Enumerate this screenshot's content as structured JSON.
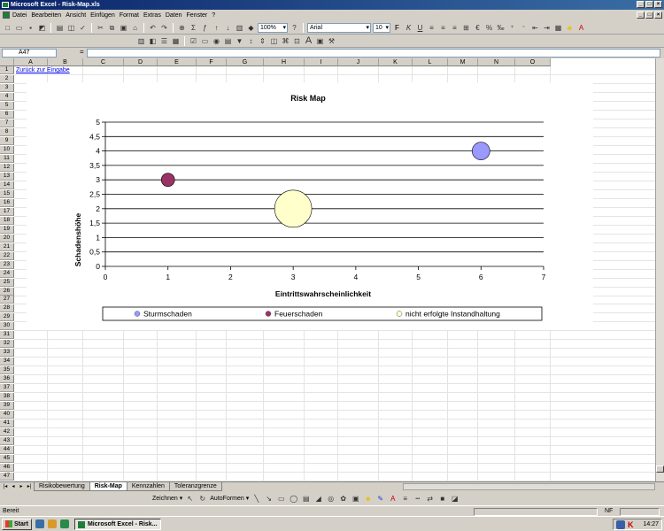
{
  "window": {
    "title": "Microsoft Excel - Risk-Map.xls",
    "controls": [
      "_",
      "□",
      "×"
    ]
  },
  "menu": {
    "items": [
      "Datei",
      "Bearbeiten",
      "Ansicht",
      "Einfügen",
      "Format",
      "Extras",
      "Daten",
      "Fenster",
      "?"
    ]
  },
  "toolbar": {
    "zoom": "100%",
    "font": "Arial",
    "font_size": "10"
  },
  "formula_bar": {
    "cell_ref": "A47",
    "equals": "=",
    "value": ""
  },
  "columns": [
    "A",
    "B",
    "C",
    "D",
    "E",
    "F",
    "G",
    "H",
    "I",
    "J",
    "K",
    "L",
    "M",
    "N",
    "O"
  ],
  "rows": [
    "1",
    "2",
    "3",
    "4",
    "5",
    "6",
    "7",
    "8",
    "9",
    "10",
    "11",
    "12",
    "13",
    "14",
    "15",
    "16",
    "17",
    "18",
    "19",
    "20",
    "21",
    "22",
    "23",
    "24",
    "25",
    "26",
    "27",
    "28",
    "29",
    "30",
    "31",
    "32",
    "33",
    "34",
    "35",
    "36",
    "37",
    "38",
    "39",
    "40",
    "41",
    "42",
    "43",
    "44",
    "45",
    "46",
    "47"
  ],
  "sheet": {
    "link_text": "Zurück zur Eingabe"
  },
  "chart_data": {
    "type": "scatter",
    "title": "Risk Map",
    "xlabel": "Eintrittswahrscheinlichkeit",
    "ylabel": "Schadenshöhe",
    "xlim": [
      0,
      7
    ],
    "ylim": [
      0,
      5
    ],
    "x_ticks": [
      "0",
      "1",
      "2",
      "3",
      "4",
      "5",
      "6",
      "7"
    ],
    "y_ticks": [
      "0",
      "0,5",
      "1",
      "1,5",
      "2",
      "2,5",
      "3",
      "3,5",
      "4",
      "4,5",
      "5"
    ],
    "grid": "horizontal",
    "legend_position": "bottom",
    "series": [
      {
        "name": "Sturmschaden",
        "x": 6,
        "y": 4,
        "size": 1,
        "color": "#9999ff"
      },
      {
        "name": "Feuerschaden",
        "x": 1,
        "y": 3,
        "size": 0.75,
        "color": "#993366"
      },
      {
        "name": "nicht erfolgte Instandhaltung",
        "x": 3,
        "y": 2,
        "size": 2.1,
        "color": "#ffffcc"
      }
    ]
  },
  "sheet_tabs": {
    "items": [
      "Risikobewertung",
      "Risk-Map",
      "Kennzahlen",
      "Toleranzgrenze"
    ],
    "active": "Risk-Map"
  },
  "drawing_toolbar": {
    "draw_label": "Zeichnen ▾",
    "autoshapes_label": "AutoFormen ▾"
  },
  "status": {
    "text": "Bereit",
    "nf": "NF"
  },
  "taskbar": {
    "start": "Start",
    "task": "Microsoft Excel - Risk...",
    "clock": "14:27"
  }
}
